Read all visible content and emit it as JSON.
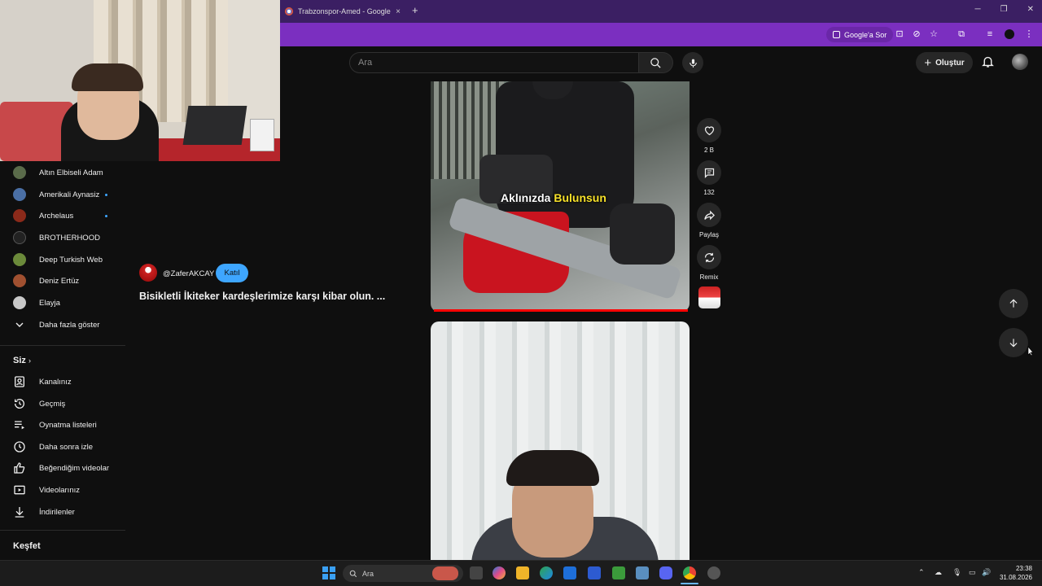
{
  "browser": {
    "tab_title": "Trabzonspor-Amed - Google'd",
    "new_tab": "+",
    "tab_close": "×",
    "google_sor": "Google'a Sor"
  },
  "youtube": {
    "search_placeholder": "Ara",
    "create_label": "Oluştur"
  },
  "sidebar": {
    "subscriptions": [
      {
        "label": "Altın Elbiseli Adam",
        "color": "#5a6b4a",
        "dot": false
      },
      {
        "label": "Amerikali Aynasiz",
        "color": "#4a6fa5",
        "dot": true
      },
      {
        "label": "Archelaus",
        "color": "#8b2a1a",
        "dot": true
      },
      {
        "label": "BROTHERHOOD",
        "color": "#222222",
        "dot": false
      },
      {
        "label": "Deep Turkish Web",
        "color": "#6b8a3a",
        "dot": false
      },
      {
        "label": "Deniz Ertüz",
        "color": "#a05030",
        "dot": false
      },
      {
        "label": "Elayja",
        "color": "#c8c8c8",
        "dot": false
      }
    ],
    "show_more": "Daha fazla göster",
    "you_section": "Siz",
    "you_items": [
      {
        "label": "Kanalınız",
        "icon": "channel-icon"
      },
      {
        "label": "Geçmiş",
        "icon": "history-icon"
      },
      {
        "label": "Oynatma listeleri",
        "icon": "playlist-icon"
      },
      {
        "label": "Daha sonra izle",
        "icon": "clock-icon"
      },
      {
        "label": "Beğendiğim videolar",
        "icon": "thumbs-up-icon"
      },
      {
        "label": "Videolarınız",
        "icon": "video-icon"
      },
      {
        "label": "İndirilenler",
        "icon": "download-icon"
      }
    ],
    "explore": "Keşfet"
  },
  "short": {
    "caption_part1": "Aklınızda",
    "caption_part2": "Bulunsun",
    "channel": "@ZaferAKCAY",
    "join": "Katıl",
    "title": "Bisikletli İkiteker kardeşlerimize karşı kibar olun. ...",
    "likes": "2 B",
    "comments": "132",
    "share": "Paylaş",
    "remix": "Remix"
  },
  "taskbar": {
    "search": "Ara",
    "time": "23:38",
    "date": "31.08.2026"
  },
  "colors": {
    "tab_bar": "#3b1f63",
    "toolbar": "#7b2fc0",
    "accent_blue": "#3ea6ff",
    "progress_red": "#ff0000",
    "caption_yellow": "#f7e12a"
  }
}
